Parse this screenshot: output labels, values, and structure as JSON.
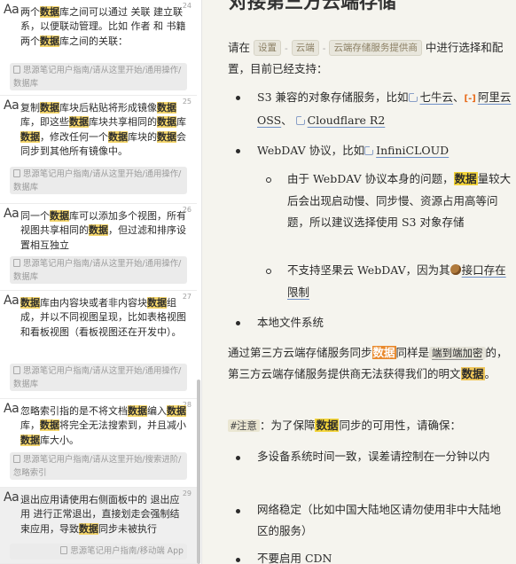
{
  "search_results": [
    {
      "type": "Aa",
      "num": "24",
      "parts": [
        [
          "两个",
          0
        ],
        [
          "数据",
          1
        ],
        [
          "库之间可以通过 关联 建立联系，以便联动管理。比如 作者 和 书籍 两个",
          0
        ],
        [
          "数据",
          1
        ],
        [
          "库之间的关联：",
          0
        ]
      ],
      "path": "思源笔记用户指南/请从这里开始/通用操作/数据库"
    },
    {
      "type": "Aa",
      "num": "25",
      "parts": [
        [
          "复制",
          0
        ],
        [
          "数据",
          1
        ],
        [
          "库块后粘贴将形成镜像",
          0
        ],
        [
          "数据",
          1
        ],
        [
          "库，即这些",
          0
        ],
        [
          "数据",
          1
        ],
        [
          "库块共享相同的",
          0
        ],
        [
          "数据",
          1
        ],
        [
          "库",
          0
        ],
        [
          "数据",
          1
        ],
        [
          "，修改任何一个",
          0
        ],
        [
          "数据",
          1
        ],
        [
          "库块的",
          0
        ],
        [
          "数据",
          1
        ],
        [
          "会同步到其他所有镜像中。",
          0
        ]
      ],
      "path": "思源笔记用户指南/请从这里开始/通用操作/数据库"
    },
    {
      "type": "Aa",
      "num": "26",
      "parts": [
        [
          "同一个",
          0
        ],
        [
          "数据",
          1
        ],
        [
          "库可以添加多个视图，所有视图共享相同的",
          0
        ],
        [
          "数据",
          1
        ],
        [
          "，但过滤和排序设置相互独立",
          0
        ]
      ],
      "path": "思源笔记用户指南/请从这里开始/通用操作/数据库"
    },
    {
      "type": "Aa",
      "num": "27",
      "parts": [
        [
          "数据",
          1
        ],
        [
          "库由内容块或者非内容块",
          0
        ],
        [
          "数据",
          1
        ],
        [
          "组成，并以不同视图呈现，比如表格视图和看板视图（看板视图还在开发中）。",
          0
        ]
      ],
      "path": "思源笔记用户指南/请从这里开始/通用操作/数据库"
    },
    {
      "type": "Aa",
      "num": "28",
      "parts": [
        [
          "忽略索引指的是不将文档",
          0
        ],
        [
          "数据",
          1
        ],
        [
          "编入",
          0
        ],
        [
          "数据",
          1
        ],
        [
          "库，",
          0
        ],
        [
          "数据",
          1
        ],
        [
          "将完全无法搜索到，并且减小",
          0
        ],
        [
          "数据",
          1
        ],
        [
          "库大小。",
          0
        ]
      ],
      "path": "思源笔记用户指南/请从这里开始/搜索进阶/忽略索引"
    },
    {
      "type": "Aa",
      "num": "29",
      "parts": [
        [
          "退出应用请使用右侧面板中的 退出应用 进行正常退出，直接划走会强制结束应用，导致",
          0
        ],
        [
          "数据",
          1
        ],
        [
          "同步未被执行",
          0
        ]
      ],
      "path": "思源笔记用户指南/移动端 App"
    }
  ],
  "doc": {
    "title": "对接第三方云端存储",
    "intro": {
      "before": "请在",
      "chips": [
        "设置",
        "云端",
        "云端存储服务提供商"
      ],
      "after": "中进行选择和配置，目前已经支持："
    },
    "bullets": {
      "s3": {
        "text": "S3 兼容的对象存储服务，比如",
        "links": [
          "七牛云",
          "阿里云 OSS",
          "Cloudflare R2"
        ],
        "ali_icon": "[-]",
        "sep1": "、",
        "sep2": "、"
      },
      "webdav": {
        "text": "WebDAV 协议，比如",
        "link": "InfiniCLOUD"
      },
      "sub1": {
        "before": "由于 WebDAV 协议本身的问题，",
        "hl": "数据",
        "after": "量较大后会出现启动慢、同步慢、资源占用高等问题，所以建议选择使用 S3 对象存储"
      },
      "sub2": {
        "before": "不支持坚果云 WebDAV，因为其",
        "link": "接口存在限制"
      },
      "local": "本地文件系统"
    },
    "para2": {
      "t1": "通过第三方云端存储服务同步",
      "hl": "数据",
      "t2": "同样是",
      "code": "端到端加密",
      "t3": "的，第三方云端存储服务提供商无法获得我们的明文",
      "hl2": "数据",
      "t4": "。"
    },
    "note": {
      "tag": "#注意",
      "t1": "：为了保障",
      "hl": "数据",
      "t2": "同步的可用性，请确保："
    },
    "note_bullets": [
      "多设备系统时间一致，误差请控制在一分钟以内",
      "网络稳定（比如中国大陆地区请勿使用非中大陆地区的服务）",
      "不要启用 CDN"
    ]
  },
  "colors": {
    "search_highlight": "#f5d66b",
    "doc_highlight_yellow": "#f4d53a",
    "doc_highlight_orange": "#e98a2e",
    "doc_background": "#f5f4ee"
  }
}
